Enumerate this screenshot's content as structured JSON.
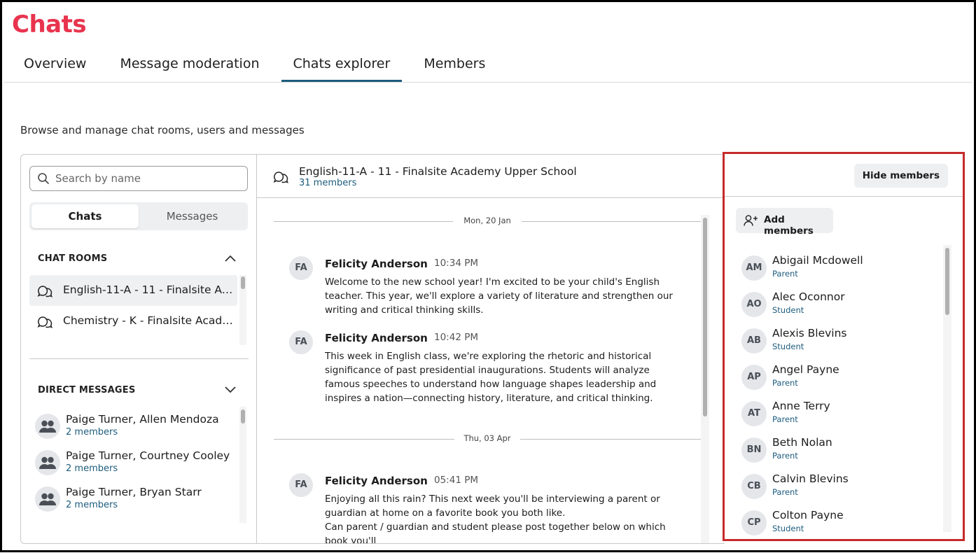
{
  "app": {
    "title": "Chats"
  },
  "tabs": [
    {
      "label": "Overview",
      "active": false
    },
    {
      "label": "Message moderation",
      "active": false
    },
    {
      "label": "Chats explorer",
      "active": true
    },
    {
      "label": "Members",
      "active": false
    }
  ],
  "subtitle": "Browse and manage chat rooms, users and messages",
  "sidebar": {
    "search_placeholder": "Search by name",
    "segments": {
      "chats": "Chats",
      "messages": "Messages",
      "selected": "Chats"
    },
    "chat_rooms_heading": "CHAT ROOMS",
    "chat_rooms": [
      {
        "name": "English-11-A - 11 - Finalsite Academy Upper School",
        "selected": true
      },
      {
        "name": "Chemistry - K - Finalsite Academy Upper School",
        "selected": false
      }
    ],
    "direct_messages_heading": "DIRECT MESSAGES",
    "direct_messages": [
      {
        "name": "Paige Turner, Allen Mendoza",
        "count": "2 members"
      },
      {
        "name": "Paige Turner, Courtney Cooley",
        "count": "2 members"
      },
      {
        "name": "Paige Turner, Bryan Starr",
        "count": "2 members"
      }
    ]
  },
  "chat": {
    "title": "English-11-A - 11 - Finalsite Academy Upper School",
    "members_count": "31 members",
    "date_separators": [
      "Mon, 20 Jan",
      "Thu, 03 Apr"
    ],
    "messages": [
      {
        "initials": "FA",
        "author": "Felicity Anderson",
        "time": "10:34 PM",
        "body": "Welcome to the new school year! I'm excited to be your child's English teacher. This year, we'll explore a variety of literature and strengthen our writing and critical thinking skills."
      },
      {
        "initials": "FA",
        "author": "Felicity Anderson",
        "time": "10:42 PM",
        "body": "This week in English class, we're exploring the rhetoric and historical significance of past presidential inaugurations. Students will analyze famous speeches to understand how language shapes leadership and inspires a nation—connecting history, literature, and critical thinking."
      },
      {
        "initials": "FA",
        "author": "Felicity Anderson",
        "time": "05:41 PM",
        "body": "Enjoying all this rain? This next week you'll be interviewing a parent or guardian at home on a favorite book you both like.",
        "body2": "Can parent / guardian and student please post together below on which book you'll"
      }
    ]
  },
  "members_panel": {
    "hide_label": "Hide members",
    "add_label": "Add members",
    "members": [
      {
        "initials": "AM",
        "name": "Abigail Mcdowell",
        "role": "Parent"
      },
      {
        "initials": "AO",
        "name": "Alec Oconnor",
        "role": "Student"
      },
      {
        "initials": "AB",
        "name": "Alexis Blevins",
        "role": "Student"
      },
      {
        "initials": "AP",
        "name": "Angel Payne",
        "role": "Parent"
      },
      {
        "initials": "AT",
        "name": "Anne Terry",
        "role": "Parent"
      },
      {
        "initials": "BN",
        "name": "Beth Nolan",
        "role": "Parent"
      },
      {
        "initials": "CB",
        "name": "Calvin Blevins",
        "role": "Parent"
      },
      {
        "initials": "CP",
        "name": "Colton Payne",
        "role": "Student"
      }
    ]
  },
  "colors": {
    "brand": "#e8344e",
    "accent": "#1d5c7e",
    "highlight_border": "#c62a2a"
  },
  "icons": [
    "search-icon",
    "chat-room-icon",
    "chevron-up-icon",
    "chevron-down-icon",
    "group-avatar-icon",
    "add-person-icon"
  ]
}
